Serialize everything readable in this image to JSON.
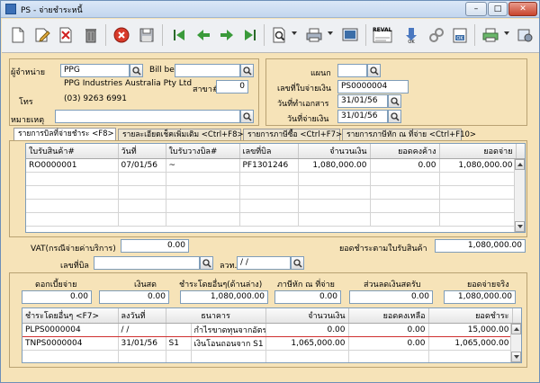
{
  "window": {
    "title": "PS - จ่ายชำระหนี้",
    "minimize": "–",
    "maximize": "□",
    "close": "✕"
  },
  "toolbar": {
    "buttons": [
      "new",
      "edit",
      "delete-doc",
      "trash",
      "cancel",
      "save",
      "first",
      "prev",
      "next",
      "last",
      "search",
      "print",
      "preview",
      "report",
      "approve",
      "link",
      "ok",
      "print2",
      "tools"
    ],
    "report_label": "REVAL"
  },
  "header": {
    "vendor_label": "ผู้จำหน่าย",
    "vendor_code": "PPG",
    "vendor_name": "PPG Industries Australia Pty Ltd",
    "billbe_label": "Bill be",
    "billbe_value": "",
    "branch_label": "สาขา#",
    "branch_value": "0",
    "phone_label": "โทร",
    "phone_value": "(03) 9263 6991",
    "remark_label": "หมายเหตุ",
    "remark_value": "",
    "dept_label": "แผนก",
    "dept_value": "",
    "payno_label": "เลขที่ใบจ่ายเงิน",
    "payno_value": "PS0000004",
    "docdate_label": "วันที่ทำเอกสาร",
    "docdate_value": "31/01/56",
    "paydate_label": "วันที่จ่ายเงิน",
    "paydate_value": "31/01/56"
  },
  "tabs": [
    "รายการบิลที่จ่ายชำระ <F8>",
    "รายละเอียดเช็คเพิ่มเติม <Ctrl+F8>",
    "รายการภาษีซื้อ <Ctrl+F7>",
    "รายการภาษีหัก ณ ที่จ่าย <Ctrl+F10>"
  ],
  "bill_table": {
    "columns": [
      "ใบรับสินค้า#",
      "วันที่",
      "ใบรับวางบิล#",
      "เลขที่บิล",
      "จำนวนเงิน",
      "ยอดคงค้าง",
      "ยอดจ่าย"
    ],
    "rows": [
      [
        "RO0000001",
        "07/01/56",
        "~",
        "PF1301246",
        "1,080,000.00",
        "0.00",
        "1,080,000.00"
      ]
    ]
  },
  "summary": {
    "vat_label": "VAT(กรณีจ่ายค่าบริการ)",
    "vat_value": "0.00",
    "total_label": "ยอดชำระตามใบรับสินค้า",
    "total_value": "1,080,000.00",
    "billno_label": "เลขที่บิล",
    "billno_value": "",
    "taxdate_label": "ลวท.",
    "taxdate_value": " /  /"
  },
  "payment": {
    "labels": [
      "ดอกเบี้ยจ่าย",
      "เงินสด",
      "ชำระโดยอื่นๆ(ด้านล่าง)",
      "ภาษีหัก ณ ที่จ่าย",
      "ส่วนลดเงินสดรับ",
      "ยอดจ่ายจริง"
    ],
    "values": [
      "0.00",
      "0.00",
      "1,080,000.00",
      "0.00",
      "0.00",
      "1,080,000.00"
    ]
  },
  "other_table": {
    "columns": [
      "ชำระโดยอื่นๆ <F7>",
      "ลงวันที่",
      "ธนาคาร",
      "จำนวนเงิน",
      "ยอดคงเหลือ",
      "ยอดชำระ"
    ],
    "rows": [
      [
        "PLPS0000004",
        " /  /",
        "",
        "กำไรขาดทุนจากอัตร",
        "0.00",
        "0.00",
        "15,000.00"
      ],
      [
        "TNPS0000004",
        "31/01/56",
        "S1",
        "เงินโอนถอนจาก S1",
        "1,065,000.00",
        "0.00",
        "1,065,000.00"
      ]
    ]
  }
}
